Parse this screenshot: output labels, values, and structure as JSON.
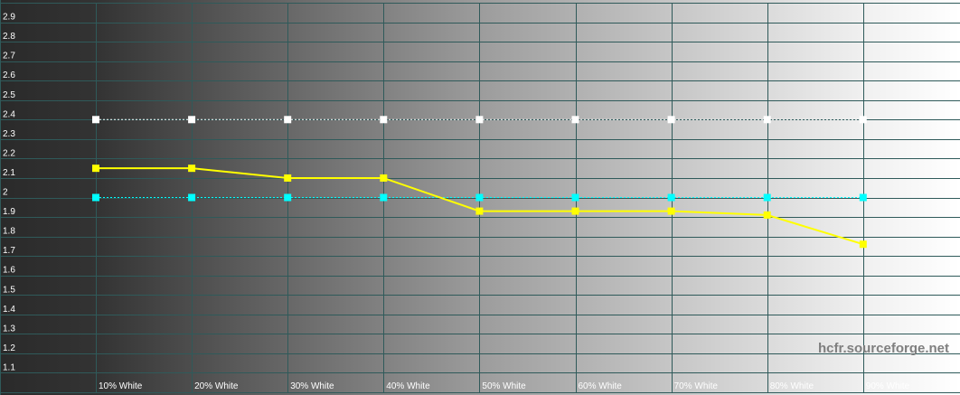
{
  "chart_data": {
    "type": "line",
    "title": "",
    "xlabel": "",
    "ylabel": "",
    "categories": [
      "10% White",
      "20% White",
      "30% White",
      "40% White",
      "50% White",
      "60% White",
      "70% White",
      "80% White",
      "90% White"
    ],
    "y_ticks": [
      "1.1",
      "1.2",
      "1.3",
      "1.4",
      "1.5",
      "1.6",
      "1.7",
      "1.8",
      "1.9",
      "2",
      "2.1",
      "2.2",
      "2.3",
      "2.4",
      "2.5",
      "2.6",
      "2.7",
      "2.8",
      "2.9"
    ],
    "ylim": [
      1.0,
      3.0
    ],
    "grid": true,
    "background": "grayscale gradient (black to white)",
    "series": [
      {
        "values": [
          2.4,
          2.4,
          2.4,
          2.4,
          2.4,
          2.4,
          2.4,
          2.4,
          2.4
        ],
        "color": "#ffffff",
        "style": "dotted"
      },
      {
        "values": [
          2.0,
          2.0,
          2.0,
          2.0,
          2.0,
          2.0,
          2.0,
          2.0,
          2.0
        ],
        "color": "#00ffff",
        "style": "dotted"
      },
      {
        "values": [
          2.15,
          2.15,
          2.1,
          2.1,
          1.93,
          1.93,
          1.93,
          1.91,
          1.76
        ],
        "color": "#ffff00",
        "style": "solid"
      }
    ]
  },
  "watermark": "hcfr.sourceforge.net",
  "colors": {
    "grid": "#2f5a5a",
    "label": "#ffffff",
    "watermark": "#7f7f7f"
  }
}
